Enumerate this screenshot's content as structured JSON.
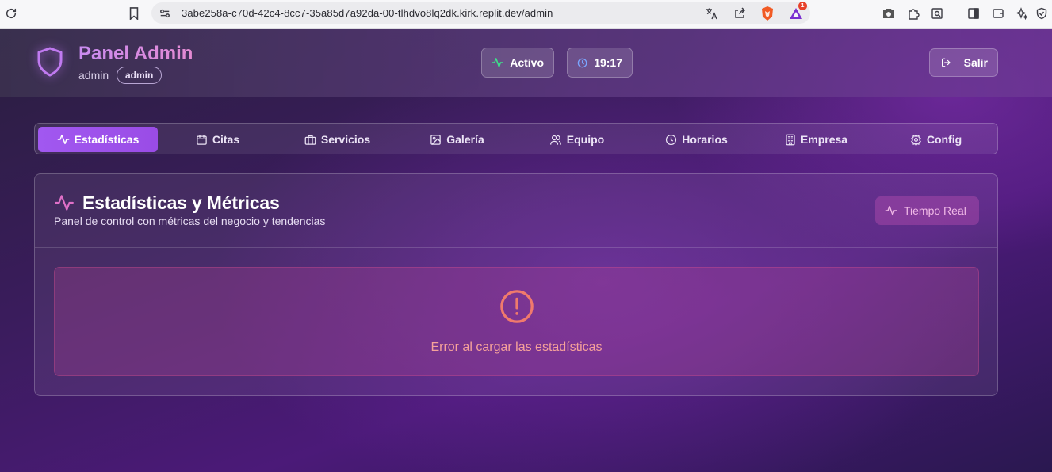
{
  "browser": {
    "url": "3abe258a-c70d-42c4-8cc7-35a85d7a92da-00-tlhdvo8lq2dk.kirk.replit.dev/admin",
    "notification_count": "1"
  },
  "header": {
    "title": "Panel Admin",
    "username": "admin",
    "role_badge": "admin",
    "status_label": "Activo",
    "clock": "19:17",
    "logout_label": "Salir"
  },
  "tabs": [
    {
      "label": "Estadísticas",
      "icon": "activity-icon",
      "active": true
    },
    {
      "label": "Citas",
      "icon": "calendar-icon",
      "active": false
    },
    {
      "label": "Servicios",
      "icon": "briefcase-icon",
      "active": false
    },
    {
      "label": "Galería",
      "icon": "image-icon",
      "active": false
    },
    {
      "label": "Equipo",
      "icon": "users-icon",
      "active": false
    },
    {
      "label": "Horarios",
      "icon": "clock-icon",
      "active": false
    },
    {
      "label": "Empresa",
      "icon": "building-icon",
      "active": false
    },
    {
      "label": "Config",
      "icon": "gear-icon",
      "active": false
    }
  ],
  "stats_card": {
    "title": "Estadísticas y Métricas",
    "subtitle": "Panel de control con métricas del negocio y tendencias",
    "realtime_label": "Tiempo Real",
    "error_message": "Error al cargar las estadísticas"
  },
  "colors": {
    "accent": "#a158f0",
    "status_green": "#3ee08a",
    "error": "#f07a6c",
    "realtime_pink": "#f0b8e6"
  }
}
